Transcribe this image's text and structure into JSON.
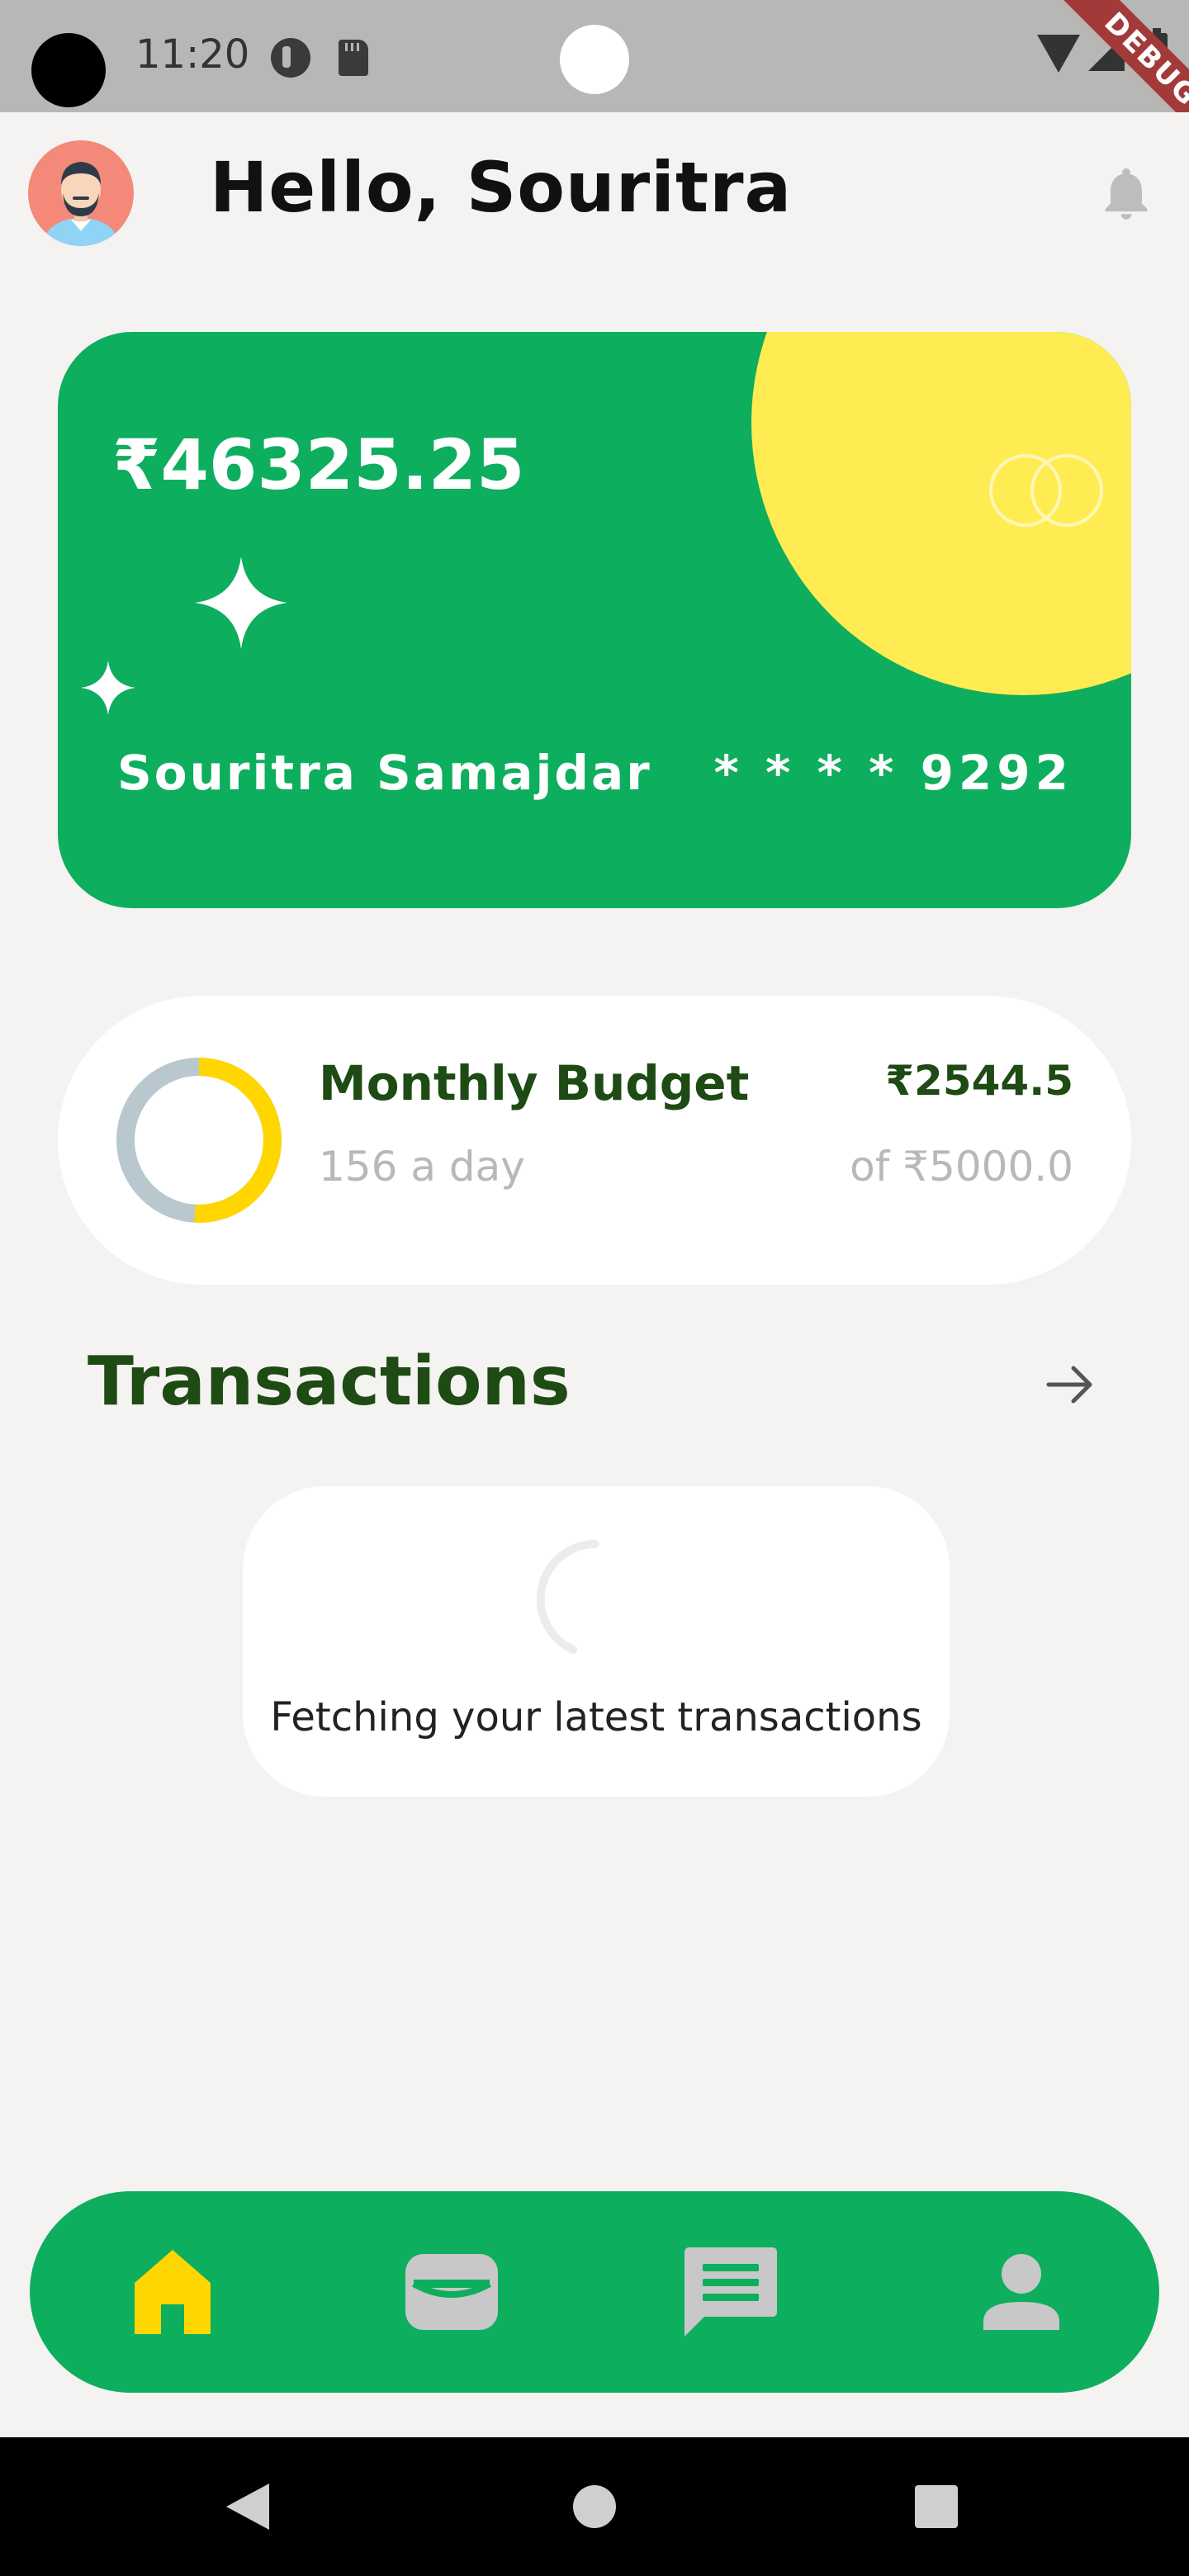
{
  "status_bar": {
    "time": "11:20",
    "debug_label": "DEBUG"
  },
  "header": {
    "greeting": "Hello, Souritra",
    "avatar_icon": "avatar-icon",
    "notification_icon": "bell-icon"
  },
  "card": {
    "balance": "₹46325.25",
    "holder_name": "Souritra Samajdar",
    "masked_number": "* * * * 9292",
    "colors": {
      "background": "#0DAE5E",
      "accent": "#FFEC52"
    }
  },
  "budget": {
    "title": "Monthly Budget",
    "spent": "₹2544.5",
    "daily": "156 a day",
    "total": "of ₹5000.0",
    "spent_fraction": 0.5089,
    "colors": {
      "progress": "#FFD600",
      "track": "#B9C8CE",
      "text": "#1E4A14"
    }
  },
  "transactions": {
    "title": "Transactions",
    "arrow_icon": "arrow-right-icon",
    "loading_text": "Fetching your latest transactions"
  },
  "bottom_nav": {
    "items": [
      {
        "icon": "home-icon",
        "active": true
      },
      {
        "icon": "wallet-icon",
        "active": false
      },
      {
        "icon": "chat-icon",
        "active": false
      },
      {
        "icon": "profile-icon",
        "active": false
      }
    ],
    "colors": {
      "background": "#0DAE5E",
      "active": "#FFD600",
      "inactive": "#C8C8C8"
    }
  }
}
